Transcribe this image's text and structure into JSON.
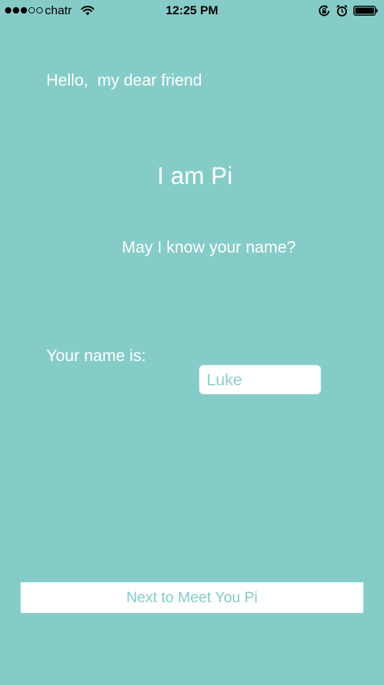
{
  "status_bar": {
    "carrier": "chatr",
    "time": "12:25 PM",
    "signal_bars_filled": 3,
    "signal_bars_total": 5,
    "icons": [
      "wifi-icon",
      "orientation-lock-icon",
      "alarm-icon",
      "battery-icon"
    ]
  },
  "main": {
    "greeting": "Hello,  my dear friend",
    "intro": "I am Pi",
    "question": "May I know your name?",
    "name_label": "Your name is:",
    "name_input": {
      "placeholder": "Luke",
      "value": ""
    },
    "next_button_label": "Next to Meet You Pi"
  },
  "colors": {
    "background": "#85ccc8",
    "text": "#ffffff",
    "button_background": "#ffffff",
    "button_text": "#85ccc8"
  }
}
